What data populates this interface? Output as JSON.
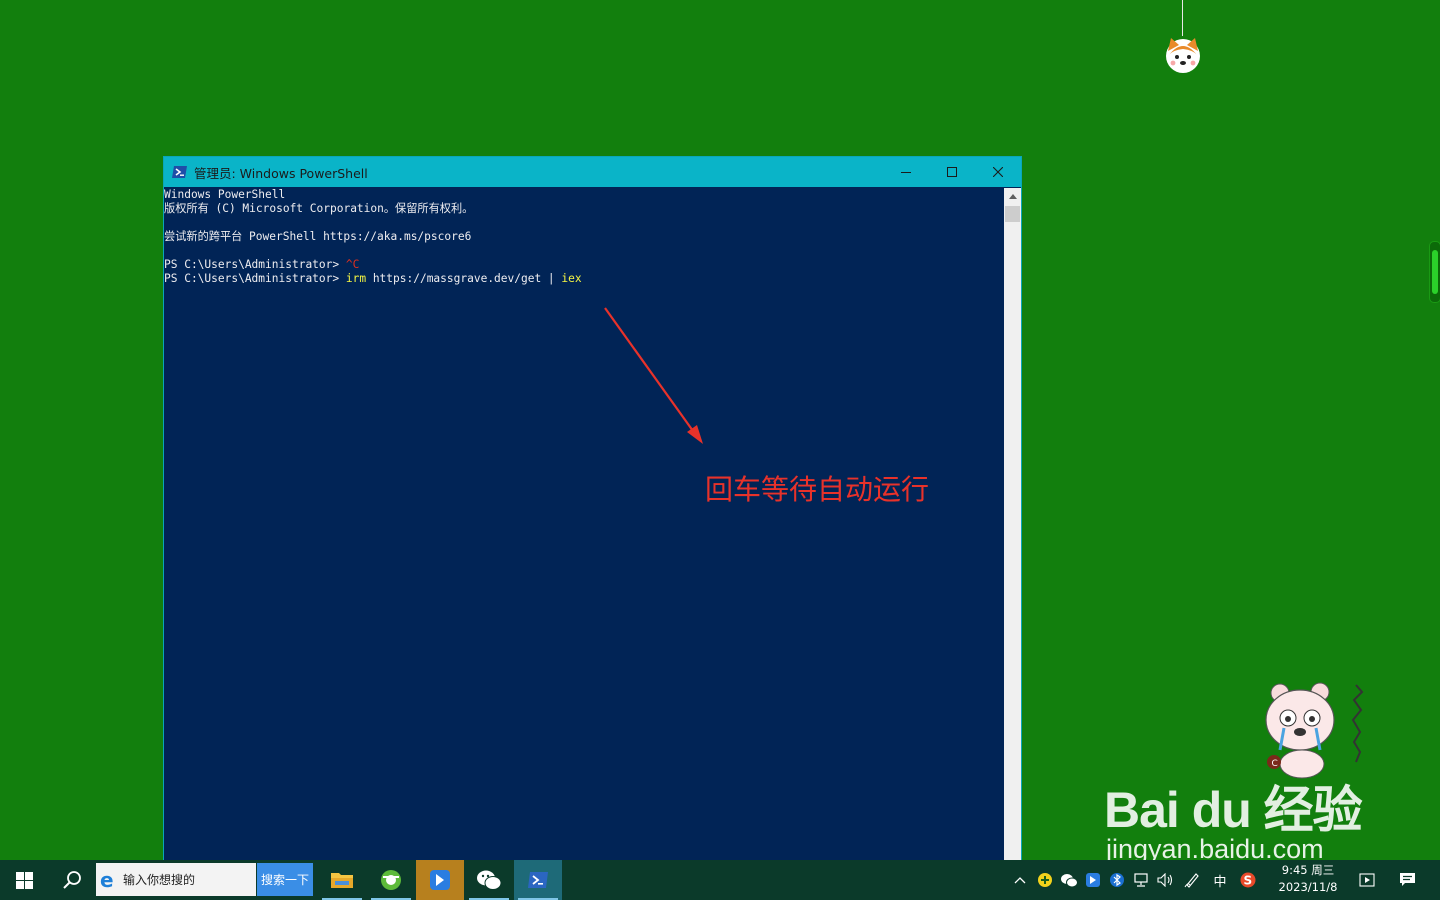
{
  "window": {
    "title": "管理员: Windows PowerShell"
  },
  "console": {
    "lines": [
      "Windows PowerShell",
      "版权所有 (C) Microsoft Corporation。保留所有权利。",
      "",
      "尝试新的跨平台 PowerShell https://aka.ms/pscore6",
      "",
      "PS C:\\Users\\Administrator> ",
      "PS C:\\Users\\Administrator> "
    ],
    "interrupt": "^C",
    "command": {
      "cmd1": "irm",
      "url": " https://massgrave.dev/get | ",
      "cmd2": "iex"
    }
  },
  "annotation": {
    "text": "回车等待自动运行"
  },
  "watermark": {
    "logo": "Bai du 经验",
    "url": "jingyan.baidu.com"
  },
  "taskbar": {
    "search_placeholder": "输入你想搜的",
    "search_button": "搜索一下",
    "apps": [
      "file-explorer",
      "browser",
      "feishu",
      "wechat",
      "powershell"
    ],
    "ime": "中",
    "time": "9:45 周三",
    "date": "2023/11/8"
  },
  "colors": {
    "desktop": "#127f0d",
    "console_bg": "#012456",
    "titlebar": "#0ab4c8",
    "annotation": "#e8322a"
  }
}
